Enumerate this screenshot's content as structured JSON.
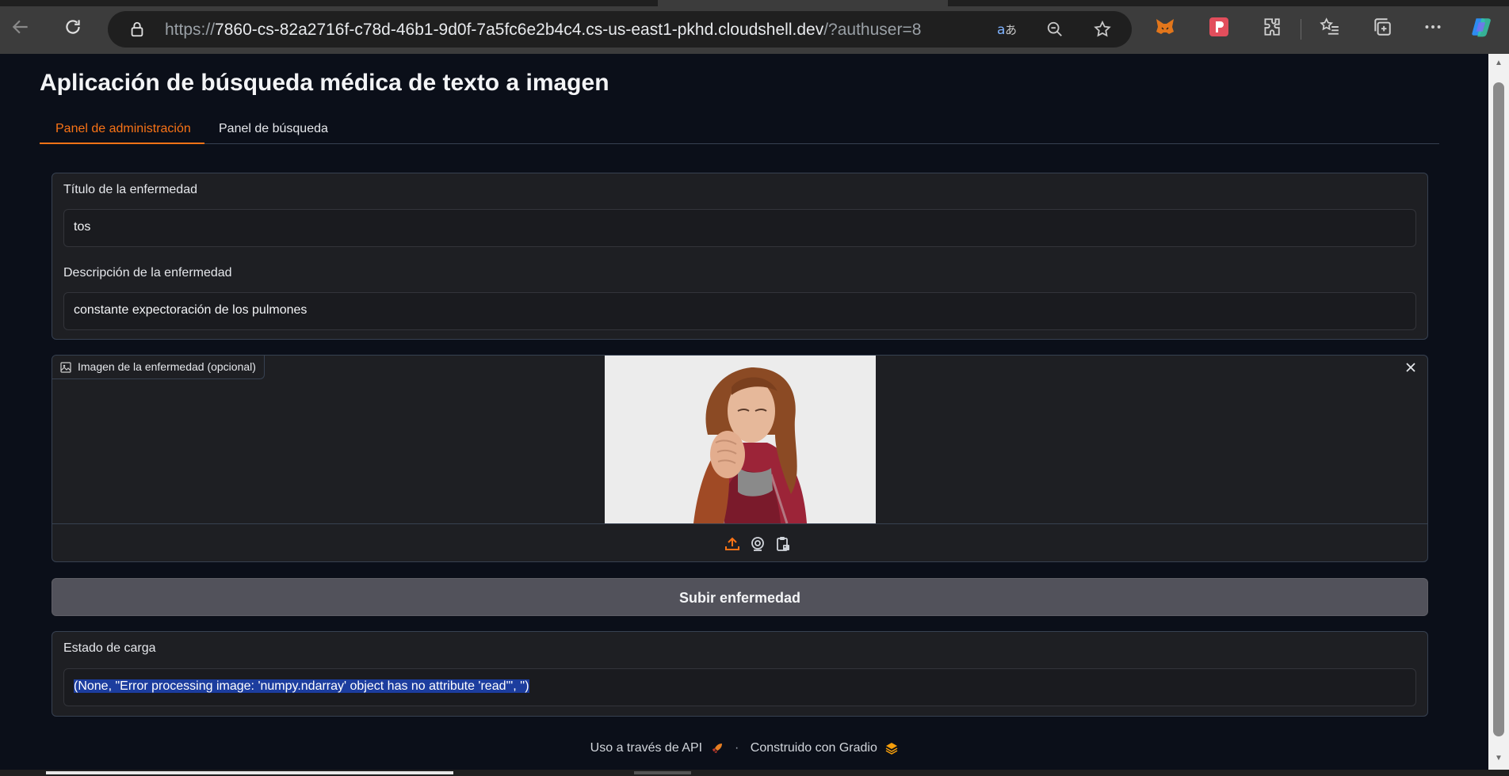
{
  "browser": {
    "url_prefix": "https://",
    "url_host": "7860-cs-82a2716f-c78d-46b1-9d0f-7a5fc6e2b4c4.cs-us-east1-pkhd.cloudshell.dev",
    "url_path": "/?authuser=8"
  },
  "app": {
    "title": "Aplicación de búsqueda médica de texto a imagen",
    "tabs": [
      {
        "label": "Panel de administración",
        "active": true
      },
      {
        "label": "Panel de búsqueda",
        "active": false
      }
    ],
    "disease_title": {
      "label": "Título de la enfermedad",
      "value": "tos"
    },
    "disease_description": {
      "label": "Descripción de la enfermedad",
      "value": "constante expectoración de los pulmones"
    },
    "image_input": {
      "label": "Imagen de la enfermedad (opcional)"
    },
    "submit_label": "Subir enfermedad",
    "status": {
      "label": "Estado de carga",
      "value": "(None, \"Error processing image: 'numpy.ndarray' object has no attribute 'read'\", '')"
    },
    "footer": {
      "api_label": "Uso a través de API",
      "separator": "·",
      "built_with": "Construido con Gradio"
    }
  },
  "colors": {
    "accent": "#f97316",
    "background": "#0b0f19",
    "selection": "#1c3d9e"
  }
}
